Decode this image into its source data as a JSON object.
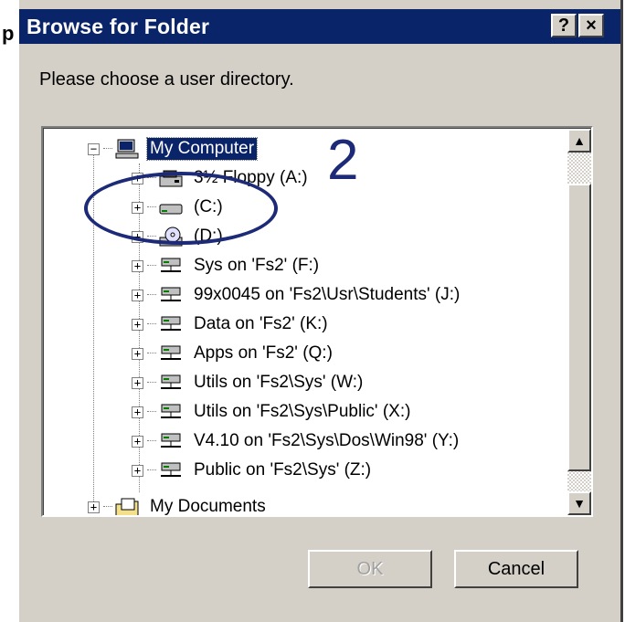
{
  "fragment_char": "p",
  "window": {
    "title": "Browse for Folder",
    "help_label": "?",
    "close_label": "×"
  },
  "prompt": "Please choose a user directory.",
  "tree": {
    "root": {
      "label": "My Computer",
      "expander": "−",
      "icon": "computer-icon",
      "selected": true
    },
    "items": [
      {
        "label": "3½ Floppy (A:)",
        "icon": "floppy-drive-icon",
        "expander": "+"
      },
      {
        "label": "(C:)",
        "icon": "hard-drive-icon",
        "expander": "+"
      },
      {
        "label": "(D:)",
        "icon": "cd-drive-icon",
        "expander": "+"
      },
      {
        "label": "Sys on 'Fs2' (F:)",
        "icon": "network-drive-icon",
        "expander": "+"
      },
      {
        "label": "99x0045 on 'Fs2\\Usr\\Students' (J:)",
        "icon": "network-drive-icon",
        "expander": "+"
      },
      {
        "label": "Data on 'Fs2' (K:)",
        "icon": "network-drive-icon",
        "expander": "+"
      },
      {
        "label": "Apps on 'Fs2' (Q:)",
        "icon": "network-drive-icon",
        "expander": "+"
      },
      {
        "label": "Utils on 'Fs2\\Sys' (W:)",
        "icon": "network-drive-icon",
        "expander": "+"
      },
      {
        "label": "Utils on 'Fs2\\Sys\\Public' (X:)",
        "icon": "network-drive-icon",
        "expander": "+"
      },
      {
        "label": "V4.10 on 'Fs2\\Sys\\Dos\\Win98' (Y:)",
        "icon": "network-drive-icon",
        "expander": "+"
      },
      {
        "label": "Public on 'Fs2\\Sys' (Z:)",
        "icon": "network-drive-icon",
        "expander": "+"
      }
    ],
    "last": {
      "label": "My Documents",
      "icon": "my-documents-icon",
      "expander": "+"
    }
  },
  "scrollbar": {
    "up_arrow": "▲",
    "down_arrow": "▼"
  },
  "buttons": {
    "ok": "OK",
    "cancel": "Cancel"
  },
  "annotation": {
    "number": "2",
    "color": "#1c2a78"
  },
  "colors": {
    "titlebar": "#0a246a",
    "face": "#d4d0c8",
    "selection": "#0a246a"
  }
}
